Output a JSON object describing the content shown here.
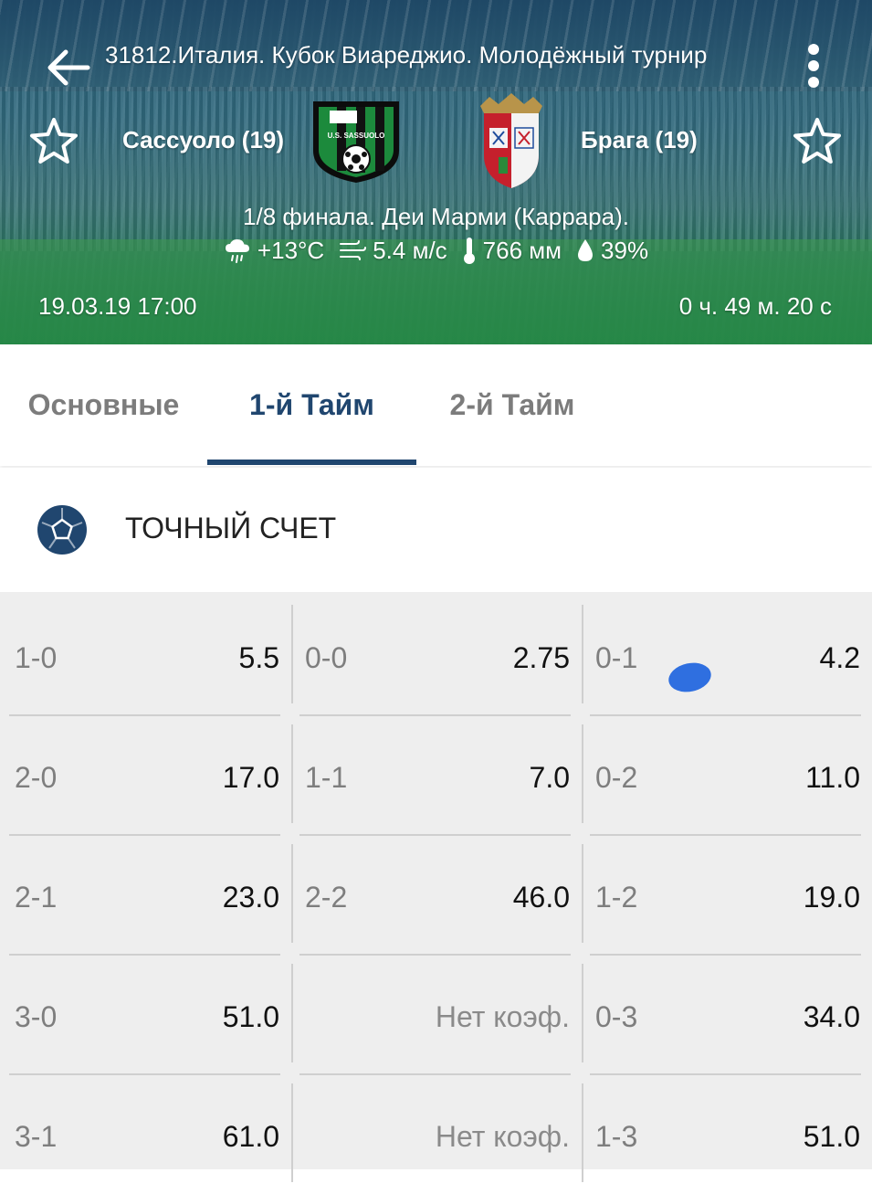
{
  "header": {
    "title": "31812.Италия. Кубок Виареджио. Молодёжный турнир",
    "home_team": "Сассуоло (19)",
    "away_team": "Брага (19)",
    "home_logo_text": "U.S. SASSUOLO",
    "stage": "1/8 финала. Деи Марми (Каррара).",
    "weather": {
      "temperature": "+13°C",
      "wind": "5.4 м/с",
      "pressure": "766 мм",
      "humidity": "39%"
    },
    "date": "19.03.19 17:00",
    "countdown": "0 ч. 49 м. 20 с"
  },
  "tabs": [
    {
      "label": "Основные",
      "active": false
    },
    {
      "label": "1-й  Тайм",
      "active": true
    },
    {
      "label": "2-й  Тайм",
      "active": false
    }
  ],
  "section": {
    "title": "ТОЧНЫЙ СЧЕТ",
    "icon": "football-icon"
  },
  "scores": {
    "rows": [
      [
        {
          "score": "1-0",
          "odd": "5.5"
        },
        {
          "score": "0-0",
          "odd": "2.75"
        },
        {
          "score": "0-1",
          "odd": "4.2"
        }
      ],
      [
        {
          "score": "2-0",
          "odd": "17.0"
        },
        {
          "score": "1-1",
          "odd": "7.0"
        },
        {
          "score": "0-2",
          "odd": "11.0"
        }
      ],
      [
        {
          "score": "2-1",
          "odd": "23.0"
        },
        {
          "score": "2-2",
          "odd": "46.0"
        },
        {
          "score": "1-2",
          "odd": "19.0"
        }
      ],
      [
        {
          "score": "3-0",
          "odd": "51.0"
        },
        {
          "score": "",
          "odd": "Нет коэф."
        },
        {
          "score": "0-3",
          "odd": "34.0"
        }
      ],
      [
        {
          "score": "3-1",
          "odd": "61.0"
        },
        {
          "score": "",
          "odd": "Нет коэф."
        },
        {
          "score": "1-3",
          "odd": "51.0"
        }
      ]
    ]
  },
  "colors": {
    "accent": "#20466f",
    "grid_bg": "#eeeeee",
    "touch_indicator": "#2f6fe0"
  }
}
